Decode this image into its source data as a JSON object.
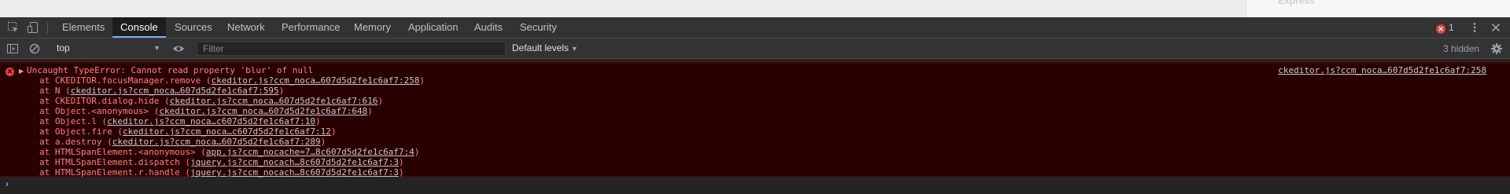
{
  "page_behind": {
    "side_text": "Express"
  },
  "devtools": {
    "tabs": [
      {
        "label": "Elements",
        "active": false
      },
      {
        "label": "Console",
        "active": true
      },
      {
        "label": "Sources",
        "active": false
      },
      {
        "label": "Network",
        "active": false
      },
      {
        "label": "Performance",
        "active": false
      },
      {
        "label": "Memory",
        "active": false
      },
      {
        "label": "Application",
        "active": false
      },
      {
        "label": "Audits",
        "active": false
      },
      {
        "label": "Security",
        "active": false
      }
    ],
    "error_count": "1",
    "icons": {
      "inspect": "inspect-element-icon",
      "device": "device-toolbar-icon",
      "menu": "kebab-menu-icon",
      "close": "close-icon"
    }
  },
  "console_toolbar": {
    "context": "top",
    "filter_placeholder": "Filter",
    "levels": "Default levels",
    "hidden": "3 hidden"
  },
  "error": {
    "message": "Uncaught TypeError: Cannot read property 'blur' of null",
    "source": "ckeditor.js?ccm_noca…607d5d2fe1c6af7:258",
    "stack": [
      {
        "fn": "at CKEDITOR.focusManager.remove (",
        "link": "ckeditor.js?ccm_noca…607d5d2fe1c6af7:258",
        "end": ")"
      },
      {
        "fn": "at N (",
        "link": "ckeditor.js?ccm_noca…607d5d2fe1c6af7:595",
        "end": ")"
      },
      {
        "fn": "at CKEDITOR.dialog.hide (",
        "link": "ckeditor.js?ccm_noca…607d5d2fe1c6af7:616",
        "end": ")"
      },
      {
        "fn": "at Object.<anonymous> (",
        "link": "ckeditor.js?ccm_noca…607d5d2fe1c6af7:648",
        "end": ")"
      },
      {
        "fn": "at Object.l (",
        "link": "ckeditor.js?ccm_noca…c607d5d2fe1c6af7:10",
        "end": ")"
      },
      {
        "fn": "at Object.fire (",
        "link": "ckeditor.js?ccm_noca…c607d5d2fe1c6af7:12",
        "end": ")"
      },
      {
        "fn": "at a.destroy (",
        "link": "ckeditor.js?ccm_noca…607d5d2fe1c6af7:289",
        "end": ")"
      },
      {
        "fn": "at HTMLSpanElement.<anonymous> (",
        "link": "app.js?ccm_nocache=7…8c607d5d2fe1c6af7:4",
        "end": ")"
      },
      {
        "fn": "at HTMLSpanElement.dispatch (",
        "link": "jquery.js?ccm_nocach…8c607d5d2fe1c6af7:3",
        "end": ")"
      },
      {
        "fn": "at HTMLSpanElement.r.handle (",
        "link": "jquery.js?ccm_nocach…8c607d5d2fe1c6af7:3",
        "end": ")"
      }
    ]
  },
  "colors": {
    "error_bg": "#290000",
    "error_text": "#ff8080",
    "accent": "#7cacf8"
  }
}
